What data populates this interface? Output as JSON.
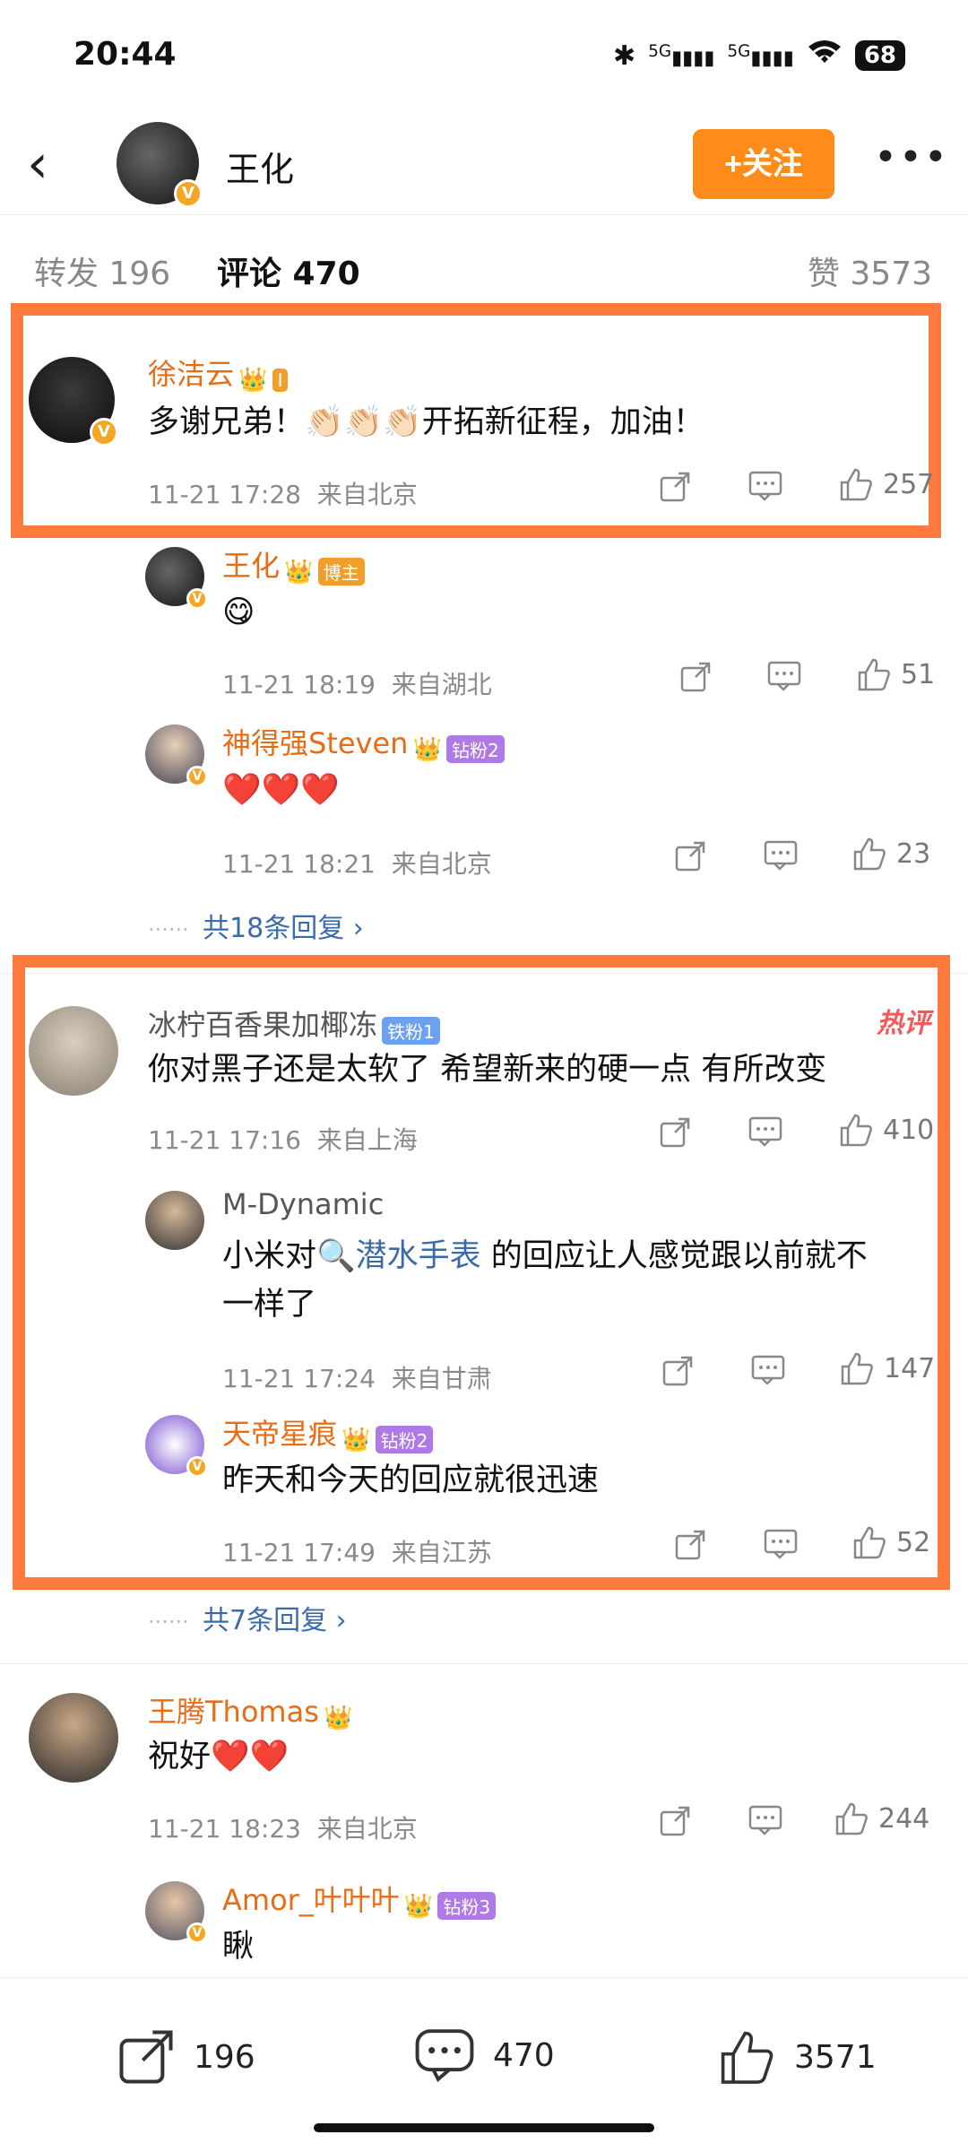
{
  "status_bar": {
    "time": "20:44",
    "battery": "68",
    "signal_1": "5G",
    "signal_2": "5G"
  },
  "header": {
    "author": "王化",
    "follow_label": "+关注",
    "more_label": "•••"
  },
  "tabs": [
    {
      "label": "转发 196"
    },
    {
      "label": "评论 470"
    },
    {
      "label": "赞 3573"
    }
  ],
  "comments": [
    {
      "user": "徐洁云",
      "badge": "I",
      "text": "多谢兄弟！👏🏻👏🏻👏🏻开拓新征程，加油！",
      "time": "11-21 17:28",
      "location": "来自北京",
      "likes": "257",
      "replies": [
        {
          "user": "王化",
          "badge": "博主",
          "text": "😋",
          "time": "11-21 18:19",
          "location": "来自湖北",
          "likes": "51"
        },
        {
          "user": "神得强Steven",
          "badge": "钻粉2",
          "text": "❤️❤️❤️",
          "time": "11-21 18:21",
          "location": "来自北京",
          "likes": "23"
        }
      ],
      "more_replies": "共18条回复 ›"
    },
    {
      "user": "冰柠百香果加椰冻",
      "badge": "铁粉1",
      "hot_label": "热评",
      "text": "你对黑子还是太软了  希望新来的硬一点  有所改变",
      "time": "11-21 17:16",
      "location": "来自上海",
      "likes": "410",
      "replies": [
        {
          "user": "M-Dynamic",
          "text_prefix": "小米对",
          "search_term": "潜水手表",
          "text_suffix": " 的回应让人感觉跟以前就不",
          "text_line2": "一样了",
          "time": "11-21 17:24",
          "location": "来自甘肃",
          "likes": "147"
        },
        {
          "user": "天帝星痕",
          "badge": "钻粉2",
          "text": "昨天和今天的回应就很迅速",
          "time": "11-21 17:49",
          "location": "来自江苏",
          "likes": "52"
        }
      ],
      "more_replies": "共7条回复 ›"
    },
    {
      "user": "王腾Thomas",
      "text": "祝好❤️❤️",
      "time": "11-21 18:23",
      "location": "来自北京",
      "likes": "244",
      "replies": [
        {
          "user": "Amor_叶叶叶",
          "badge": "钻粉3",
          "text": "瞅"
        }
      ]
    }
  ],
  "bottom_bar": {
    "reposts": "196",
    "comments": "470",
    "likes": "3571"
  },
  "colors": {
    "accent": "#ff8c1a",
    "username": "#e86c14",
    "highlight_box": "#ff7a3d",
    "link": "#3b6aa8"
  },
  "icons": [
    "bluetooth-icon",
    "wifi-icon",
    "share-icon",
    "comment-icon",
    "like-icon",
    "crown-icon",
    "verified-icon",
    "search-icon"
  ]
}
